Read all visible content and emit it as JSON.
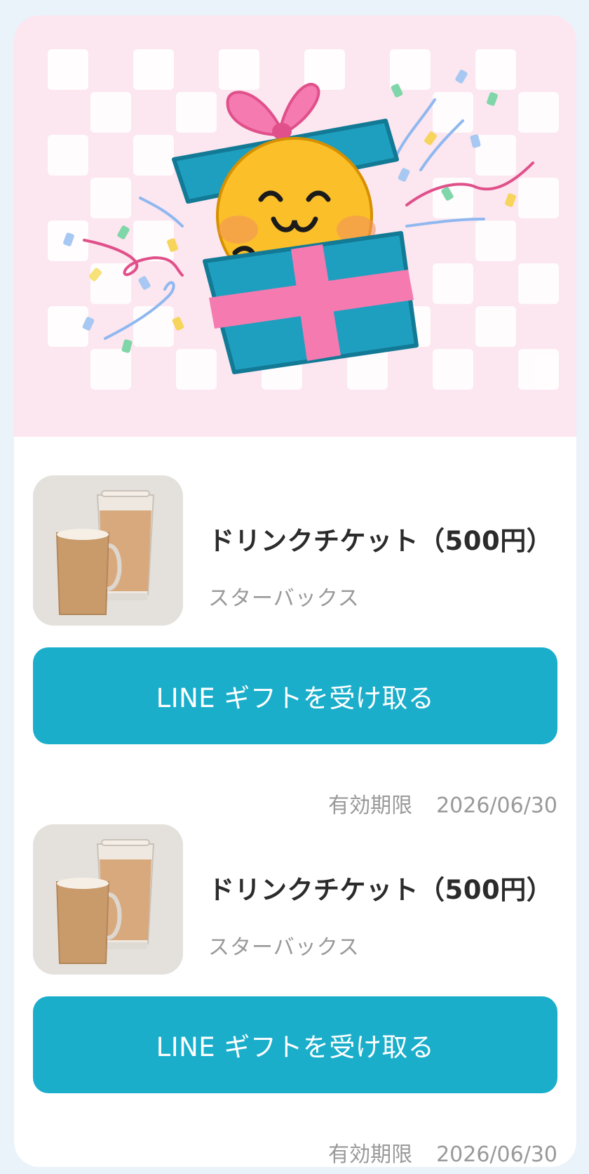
{
  "tickets": [
    {
      "title": "ドリンクチケット（500円）",
      "brand": "スターバックス",
      "button_label": "LINE ギフトを受け取る",
      "expiry_label": "有効期限",
      "expiry_date": "2026/06/30"
    },
    {
      "title": "ドリンクチケット（500円）",
      "brand": "スターバックス",
      "button_label": "LINE ギフトを受け取る",
      "expiry_label": "有効期限",
      "expiry_date": "2026/06/30"
    }
  ],
  "colors": {
    "background": "#eaf2fa",
    "hero_background": "#fce6ef",
    "button": "#1baecb",
    "gift_box": "#1f9fbf",
    "ribbon": "#f57ab0"
  }
}
